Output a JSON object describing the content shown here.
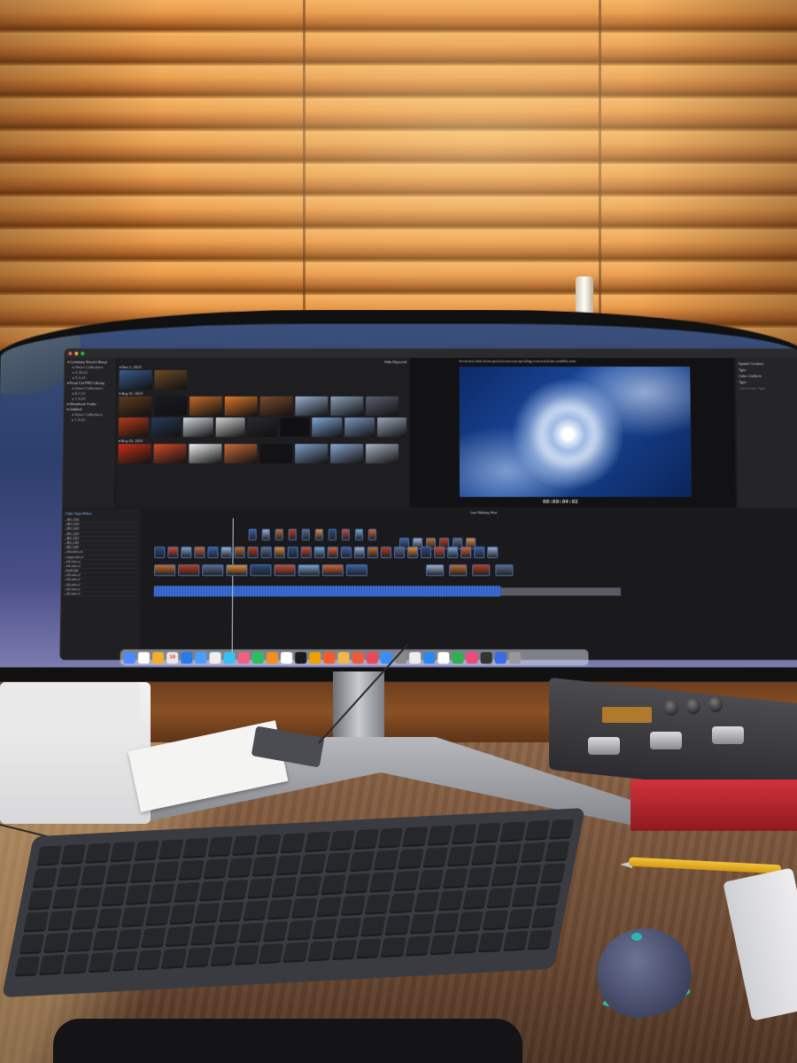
{
  "fcp": {
    "sidebar": [
      {
        "label": "Luminary Visual Library",
        "sub": false
      },
      {
        "label": "Smart Collections",
        "sub": true
      },
      {
        "label": "3-18-15",
        "sub": true
      },
      {
        "label": "9-1-22",
        "sub": true
      },
      {
        "label": "Final Cut PRO Library",
        "sub": false
      },
      {
        "label": "Smart Collections",
        "sub": true
      },
      {
        "label": "8-7-22",
        "sub": true
      },
      {
        "label": "7-9-20",
        "sub": true
      },
      {
        "label": "Weedtrust Trailer",
        "sub": false
      },
      {
        "label": "Untitled",
        "sub": false
      },
      {
        "label": "Smart Collections",
        "sub": true
      },
      {
        "label": "7-9-20",
        "sub": true
      }
    ],
    "browser": {
      "groups": [
        {
          "header": "Nov 2, 2023",
          "thumbs": [
            "#3a5a8a",
            "#6b4a2a"
          ]
        },
        {
          "header": "Aug 10, 2023",
          "thumbs": [
            "#5e3a1c",
            "#1a1a22",
            "#c06a2a",
            "#d8782a",
            "#7a4a2a",
            "#9ab0d0",
            "#8aa0b8",
            "#5a6070"
          ]
        },
        {
          "header": "",
          "thumbs": [
            "#b23a1a",
            "#2a3a5a",
            "#d0d8e0",
            "#d4d4d4",
            "#2a2a30",
            "#101014",
            "#7fa6d6",
            "#7a96c0",
            "#9aa8b8"
          ]
        },
        {
          "header": "May 23, 2023",
          "thumbs": [
            "#c4301a",
            "#d04a2a",
            "#f0f0f0",
            "#c86a3a",
            "#15151a",
            "#7fa0c8",
            "#8aa6d0",
            "#a8b4c4"
          ]
        }
      ],
      "hide_rejected": "Hide Rejected"
    },
    "viewer": {
      "title": "hurricane-clear-from-space-hurricane-spiraling-in-ocean-from-satellite-view",
      "timecode": "00:00:04:02"
    },
    "inspector": [
      {
        "label": "Spatial Conform",
        "dim": false
      },
      {
        "label": "Type",
        "dim": false
      },
      {
        "label": "Color Conform",
        "dim": false
      },
      {
        "label": "Type",
        "dim": false
      },
      {
        "label": "Conversion Type",
        "dim": true
      }
    ],
    "index": {
      "tabs": "Clips   Tags   Roles",
      "rows": [
        "IMG_0035",
        "IMG_0076",
        "IMG_0003",
        "IMG_0020",
        "IMG_0053",
        "IMG_0008",
        "IMG_0039",
        "silhouettes-of-",
        "rough-storm-cl",
        "still-views-cl",
        "still-views-cl",
        "bright-light",
        "still-views-cl",
        "still-views-cl",
        "still-views-cl",
        "still-views-cl",
        "still-views-cl"
      ]
    },
    "timeline": {
      "title": "Last Waiting Hurt",
      "clip_colors": [
        "#3a5fa0",
        "#9ab0d0",
        "#c06a2a",
        "#b83a1a",
        "#5a6a8a",
        "#e08a3a",
        "#2a4a7a",
        "#c44a2a",
        "#7aa0c8",
        "#d06030"
      ]
    }
  },
  "dock": {
    "calendar_day": "19",
    "icons": [
      "#4a8cff",
      "#fff",
      "#f0b02a",
      "#e8e8e8",
      "#2a7ae8",
      "#4aa0ff",
      "#eee",
      "#3ac0f0",
      "#f06080",
      "#2ac060",
      "#f09020",
      "#fff",
      "#1a1a1a",
      "#f0a000",
      "#fa5a2a",
      "#f0b84a",
      "#f05a3a",
      "#e84a5a",
      "#3a8ef8",
      "#888",
      "#eee",
      "#2a8af0",
      "#fff",
      "#30b050",
      "#f04a7a",
      "#333",
      "#3a6ae8",
      "#999"
    ]
  },
  "colors": {
    "blind_light": "#f3b262",
    "blind_dark": "#7c4518",
    "desk": "#6c4a33",
    "mouse_accent": "#2cb8b0"
  }
}
